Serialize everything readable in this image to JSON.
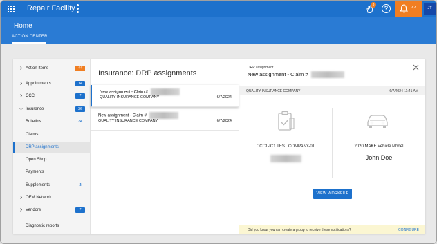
{
  "topbar": {
    "app_title": "Repair Facility",
    "hand_badge": "3",
    "notification_count": "44",
    "avatar_initials": "JT",
    "accent": "#1d71cc",
    "notify_color": "#f07e22"
  },
  "subheader": {
    "page_title": "Home",
    "tab_label": "ACTION CENTER"
  },
  "sidebar": {
    "items": [
      {
        "label": "Action Items",
        "badge": "44",
        "badge_style": "orange",
        "chevron": "right"
      },
      {
        "label": "Appointments",
        "badge": "14",
        "badge_style": "blue",
        "chevron": "right"
      },
      {
        "label": "CCC",
        "badge": "7",
        "badge_style": "blue",
        "chevron": "right"
      },
      {
        "label": "Insurance",
        "badge": "36",
        "badge_style": "blue",
        "chevron": "down"
      },
      {
        "label": "Bulletins",
        "badge": "34",
        "badge_style": "plain",
        "chevron": ""
      },
      {
        "label": "Claims",
        "badge": "",
        "badge_style": "",
        "chevron": ""
      },
      {
        "label": "DRP assignments",
        "badge": "",
        "badge_style": "",
        "chevron": "",
        "active": true
      },
      {
        "label": "Open Shop",
        "badge": "",
        "badge_style": "",
        "chevron": ""
      },
      {
        "label": "Payments",
        "badge": "",
        "badge_style": "",
        "chevron": ""
      },
      {
        "label": "Supplements",
        "badge": "2",
        "badge_style": "plain",
        "chevron": ""
      },
      {
        "label": "OEM Network",
        "badge": "",
        "badge_style": "",
        "chevron": "right"
      },
      {
        "label": "Vendors",
        "badge": "7",
        "badge_style": "blue",
        "chevron": "right"
      },
      {
        "label": "Diagnostic reports",
        "badge": "",
        "badge_style": "",
        "chevron": ""
      }
    ]
  },
  "list": {
    "title": "Insurance: DRP assignments",
    "items": [
      {
        "title": "New assignment - Claim #",
        "company": "QUALITY INSURANCE COMPANY",
        "date": "6/7/2024"
      },
      {
        "title": "New assignment - Claim #",
        "company": "QUALITY INSURANCE COMPANY",
        "date": "6/7/2024"
      }
    ]
  },
  "detail": {
    "overline": "DRP assignment",
    "heading": "New assignment - Claim #",
    "company": "QUALITY INSURANCE COMPANY",
    "datetime": "6/7/2024 11:41 AM",
    "left_caption": "CCC1-IC1 TEST COMPANY-01",
    "vehicle": "2020 MAKE Vehicle Model",
    "owner": "John Doe",
    "button_label": "VIEW WORKFILE",
    "tip": "Did you know you can create a group to receive these notifications?",
    "configure": "CONFIGURE"
  }
}
